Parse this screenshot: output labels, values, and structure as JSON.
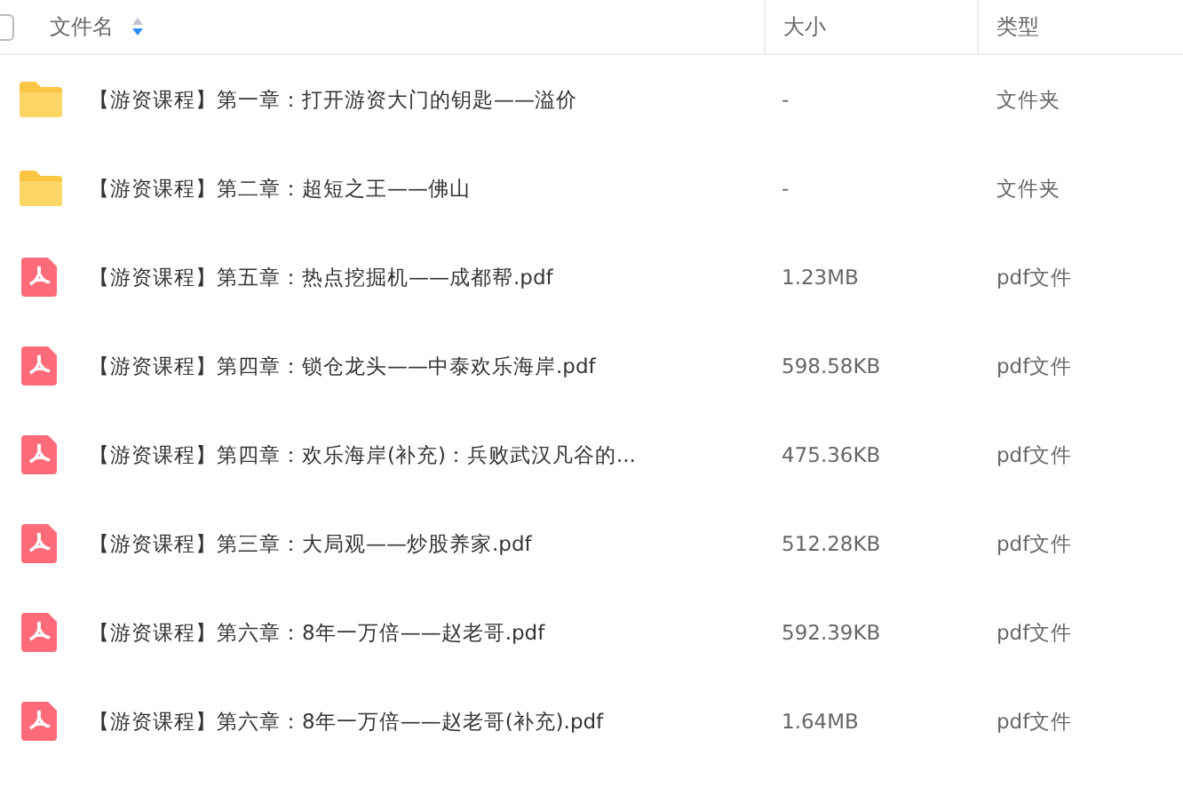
{
  "header": {
    "select_all": {
      "checked": false
    },
    "columns": [
      {
        "label": "文件名",
        "descending": true
      },
      {
        "label": "大小"
      },
      {
        "label": "类型"
      }
    ]
  },
  "rows": [
    {
      "kind": "folder",
      "name": "【游资课程】第一章：打开游资大门的钥匙——溢价",
      "size": "-",
      "type": "文件夹"
    },
    {
      "kind": "folder",
      "name": "【游资课程】第二章：超短之王——佛山",
      "size": "-",
      "type": "文件夹"
    },
    {
      "kind": "pdf",
      "name": "【游资课程】第五章：热点挖掘机——成都帮.pdf",
      "size": "1.23MB",
      "type": "pdf文件"
    },
    {
      "kind": "pdf",
      "name": "【游资课程】第四章：锁仓龙头——中泰欢乐海岸.pdf",
      "size": "598.58KB",
      "type": "pdf文件"
    },
    {
      "kind": "pdf",
      "name": "【游资课程】第四章：欢乐海岸(补充)：兵败武汉凡谷的...",
      "size": "475.36KB",
      "type": "pdf文件"
    },
    {
      "kind": "pdf",
      "name": "【游资课程】第三章：大局观——炒股养家.pdf",
      "size": "512.28KB",
      "type": "pdf文件"
    },
    {
      "kind": "pdf",
      "name": "【游资课程】第六章：8年一万倍——赵老哥.pdf",
      "size": "592.39KB",
      "type": "pdf文件"
    },
    {
      "kind": "pdf",
      "name": "【游资课程】第六章：8年一万倍——赵老哥(补充).pdf",
      "size": "1.64MB",
      "type": "pdf文件"
    }
  ]
}
